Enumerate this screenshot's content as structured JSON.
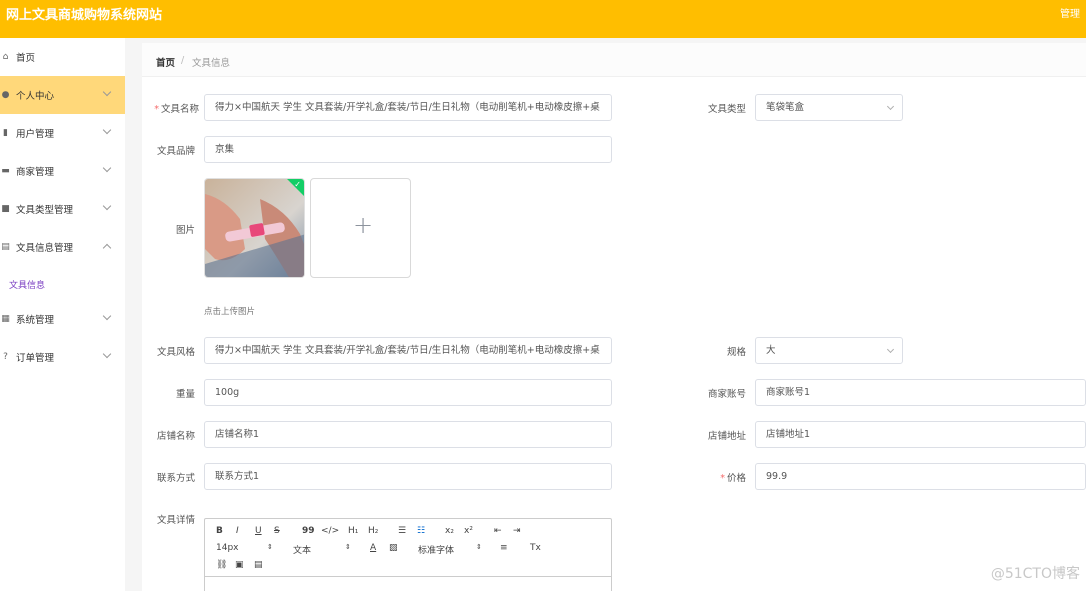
{
  "header": {
    "title": "网上文具商城购物系统网站",
    "admin": "管理"
  },
  "sidebar": {
    "items": [
      {
        "label": "首页",
        "icon": "home-icon"
      },
      {
        "label": "个人中心",
        "icon": "user-icon"
      },
      {
        "label": "用户管理",
        "icon": "bar-chart-icon"
      },
      {
        "label": "商家管理",
        "icon": "shop-icon"
      },
      {
        "label": "文具类型管理",
        "icon": "tag-icon"
      },
      {
        "label": "文具信息管理",
        "icon": "document-icon"
      },
      {
        "label": "系统管理",
        "icon": "grid-icon"
      },
      {
        "label": "订单管理",
        "icon": "help-icon"
      }
    ],
    "submenu": {
      "label": "文具信息"
    }
  },
  "breadcrumb": {
    "home": "首页",
    "separator": "/",
    "current": "文具信息"
  },
  "form": {
    "name_label": "文具名称",
    "name_value": "得力×中国航天 学生 文具套装/开学礼盒/套装/节日/生日礼物（电动削笔机+电动橡皮擦+桌",
    "type_label": "文具类型",
    "type_value": "笔袋笔盒",
    "brand_label": "文具品牌",
    "brand_value": "京集",
    "image_label": "图片",
    "upload_tip": "点击上传图片",
    "style_label": "文具风格",
    "style_value": "得力×中国航天 学生 文具套装/开学礼盒/套装/节日/生日礼物（电动削笔机+电动橡皮擦+桌",
    "spec_label": "规格",
    "spec_value": "大",
    "weight_label": "重量",
    "weight_value": "100g",
    "merchant_label": "商家账号",
    "merchant_value": "商家账号1",
    "shop_name_label": "店铺名称",
    "shop_name_value": "店铺名称1",
    "shop_addr_label": "店铺地址",
    "shop_addr_value": "店铺地址1",
    "contact_label": "联系方式",
    "contact_value": "联系方式1",
    "price_label": "价格",
    "price_value": "99.9",
    "detail_label": "文具详情",
    "required_mark": "*"
  },
  "editor": {
    "font_size": "14px",
    "text_style": "文本",
    "font_family": "标准字体",
    "btn_bold": "B",
    "btn_italic": "I",
    "btn_underline": "U",
    "btn_strike": "S",
    "btn_quote": "99",
    "btn_code": "</>",
    "btn_h1": "H₁",
    "btn_h2": "H₂",
    "btn_ol": "☰",
    "btn_ul": "☷",
    "btn_sub": "x₂",
    "btn_sup": "x²",
    "btn_outdent": "⇤",
    "btn_indent": "⇥",
    "btn_color": "A",
    "btn_bg": "▨",
    "btn_align": "≡",
    "btn_clear": "Tx",
    "btn_link": "⛓",
    "btn_image": "▣",
    "btn_video": "▤"
  },
  "watermark": "@51CTO博客",
  "colors": {
    "header": "#ffbe00",
    "active_menu": "#ffd87a",
    "required": "#f56c6c",
    "check": "#13ce66"
  }
}
